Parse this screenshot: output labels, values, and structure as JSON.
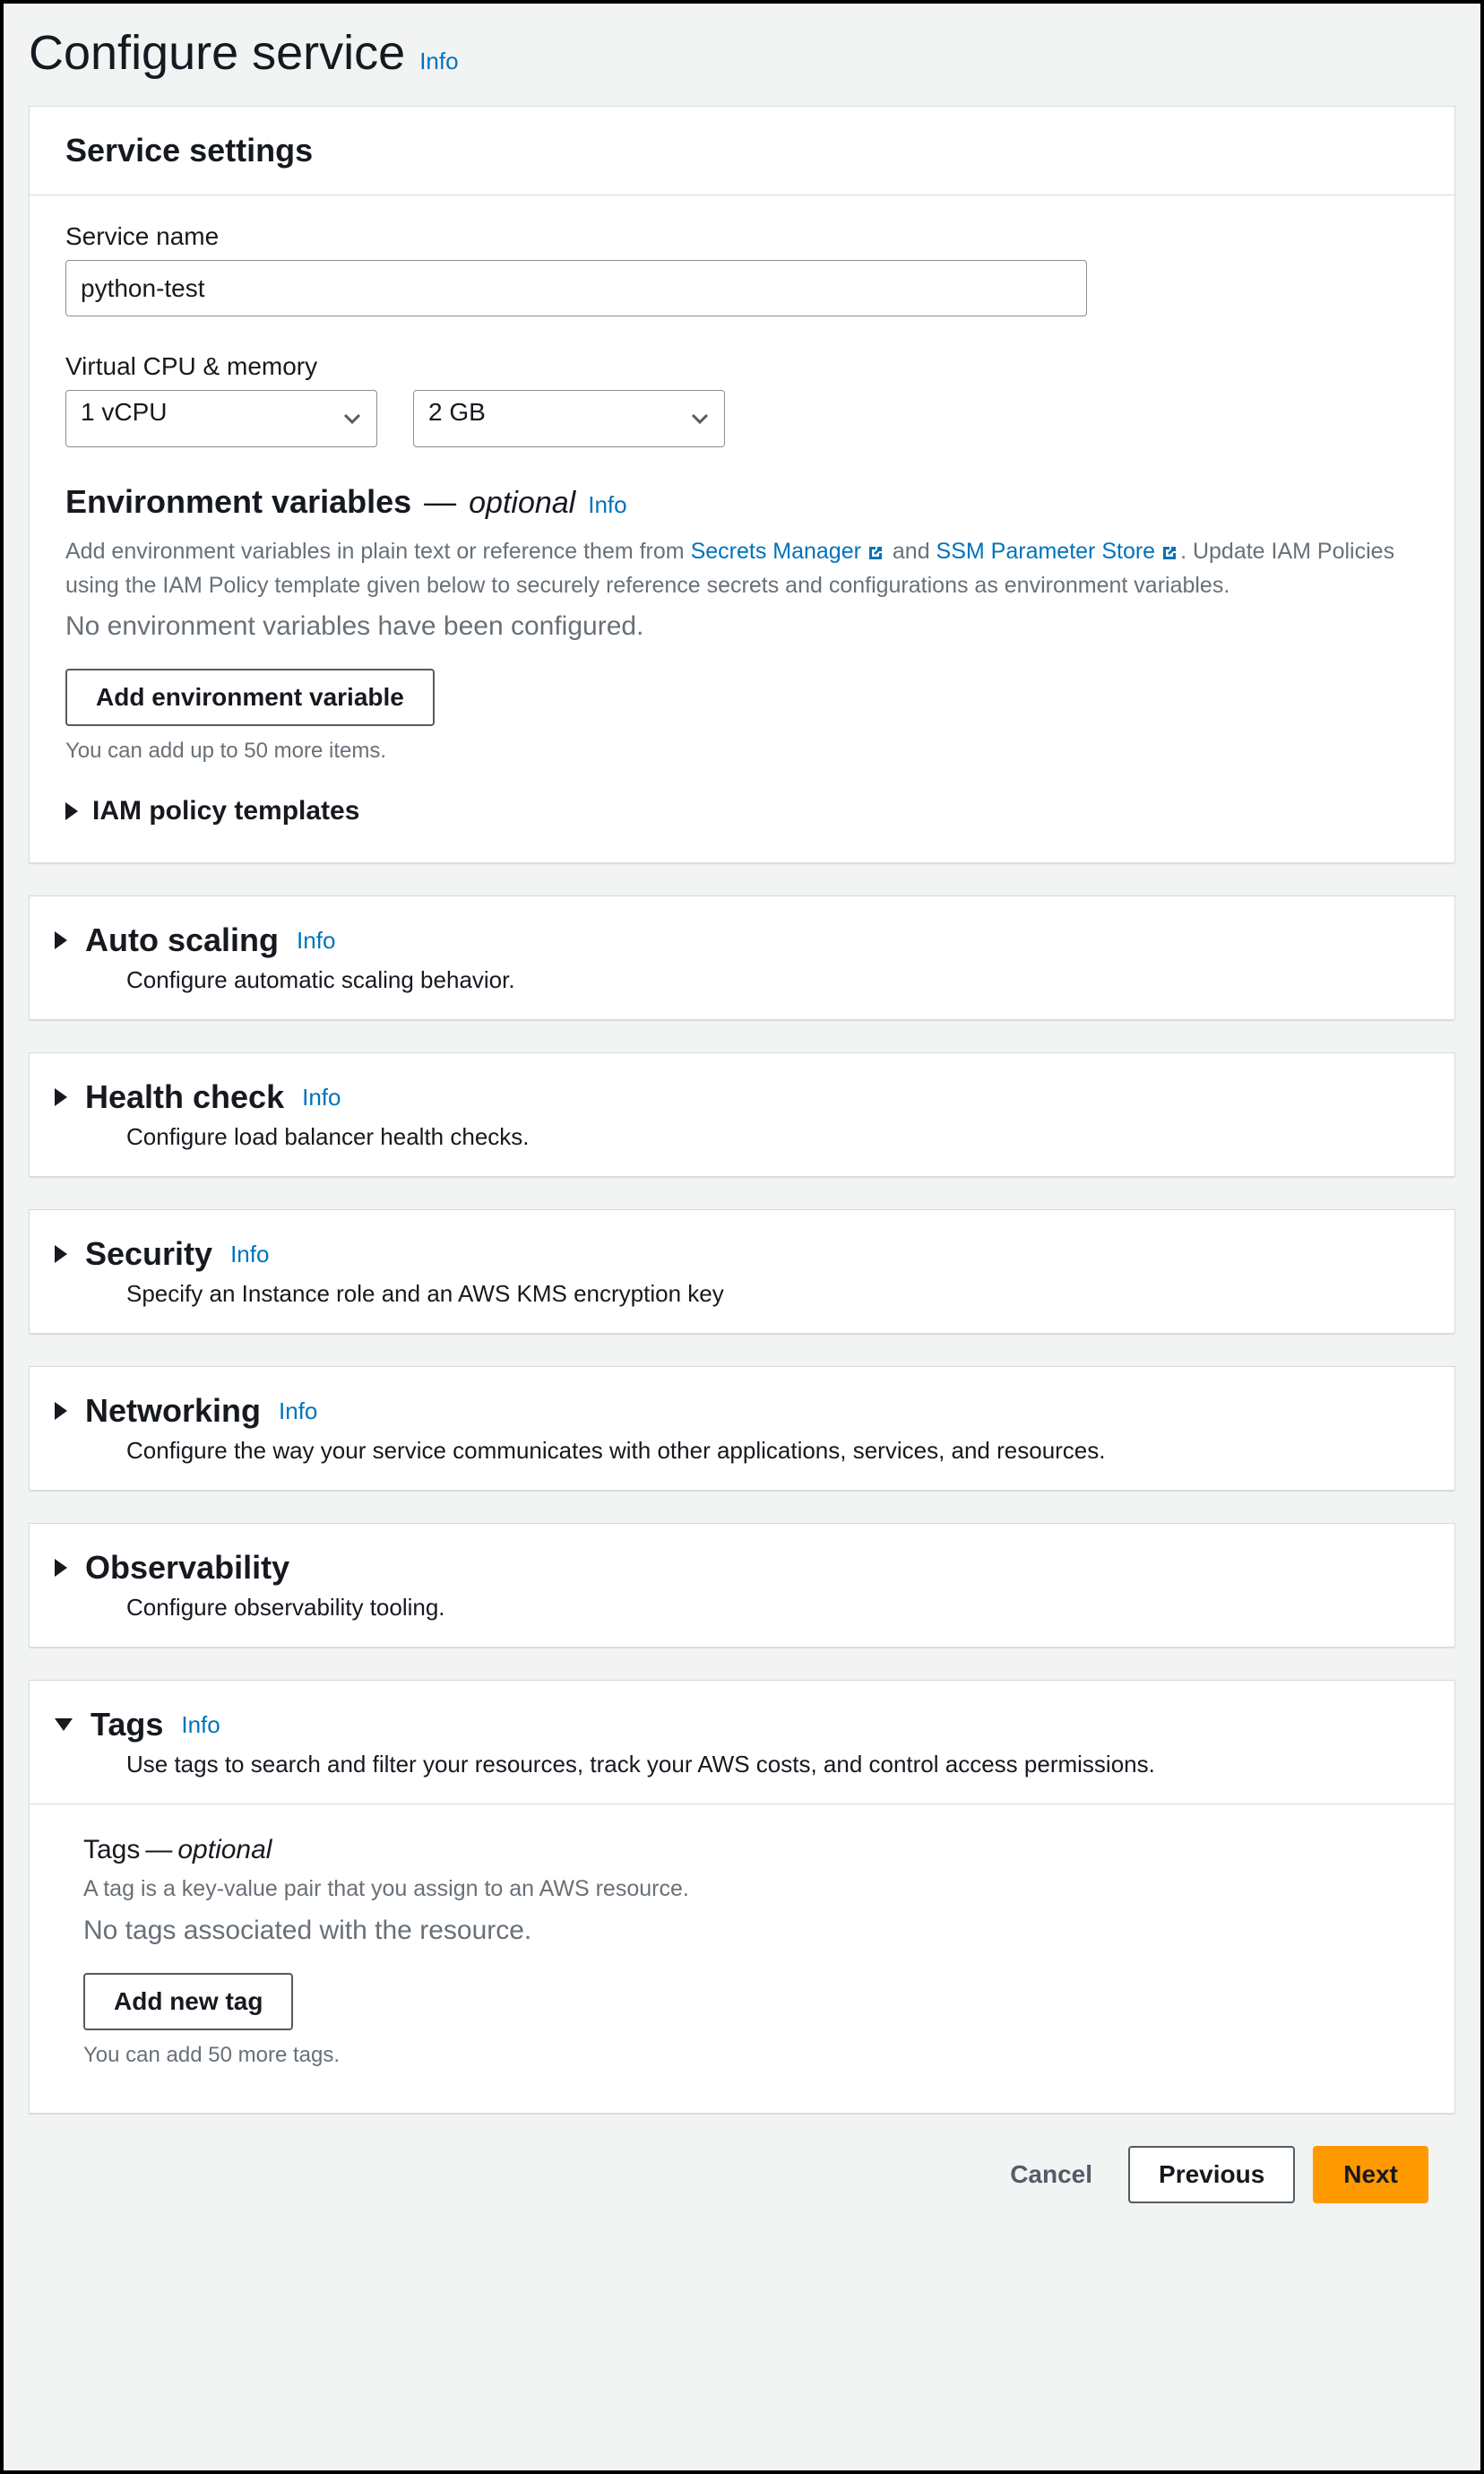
{
  "page": {
    "title": "Configure service",
    "info": "Info"
  },
  "serviceSettings": {
    "title": "Service settings",
    "serviceNameLabel": "Service name",
    "serviceNameValue": "python-test",
    "vcpuMemLabel": "Virtual CPU & memory",
    "vcpuValue": "1 vCPU",
    "memValue": "2 GB",
    "envVars": {
      "title": "Environment variables",
      "dash": "—",
      "optional": "optional",
      "info": "Info",
      "helpPrefix": "Add environment variables in plain text or reference them from ",
      "secretsManager": "Secrets Manager",
      "helpMid": " and ",
      "ssm": "SSM Parameter Store",
      "helpSuffix": ". Update IAM Policies using the IAM Policy template given below to securely reference secrets and configurations as environment variables.",
      "emptyMsg": "No environment variables have been configured.",
      "addBtn": "Add environment variable",
      "limitNote": "You can add up to 50 more items.",
      "iamPolicy": "IAM policy templates"
    }
  },
  "autoScaling": {
    "title": "Auto scaling",
    "info": "Info",
    "desc": "Configure automatic scaling behavior."
  },
  "healthCheck": {
    "title": "Health check",
    "info": "Info",
    "desc": "Configure load balancer health checks."
  },
  "security": {
    "title": "Security",
    "info": "Info",
    "desc": "Specify an Instance role and an AWS KMS encryption key"
  },
  "networking": {
    "title": "Networking",
    "info": "Info",
    "desc": "Configure the way your service communicates with other applications, services, and resources."
  },
  "observability": {
    "title": "Observability",
    "desc": "Configure observability tooling."
  },
  "tags": {
    "title": "Tags",
    "info": "Info",
    "desc": "Use tags to search and filter your resources, track your AWS costs, and control access permissions.",
    "bodyTitle": "Tags",
    "bodyDash": "—",
    "bodyOptional": "optional",
    "bodyHelp": "A tag is a key-value pair that you assign to an AWS resource.",
    "emptyMsg": "No tags associated with the resource.",
    "addBtn": "Add new tag",
    "limitNote": "You can add 50 more tags."
  },
  "footer": {
    "cancel": "Cancel",
    "previous": "Previous",
    "next": "Next"
  }
}
